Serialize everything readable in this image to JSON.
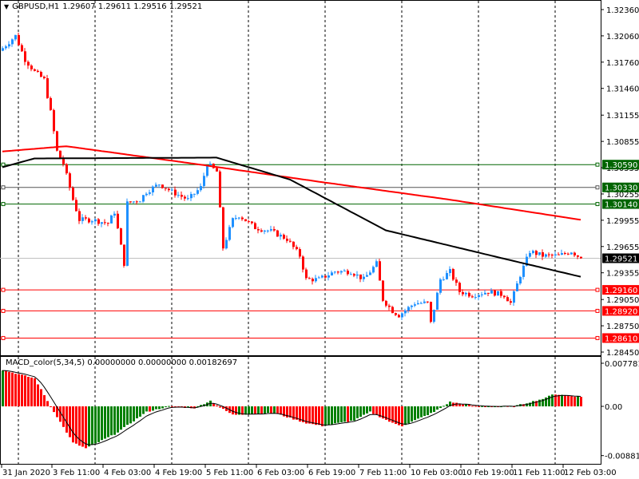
{
  "header": {
    "symbol": "GBPUSD,H1",
    "ohlc": "1.29607 1.29611 1.29516 1.29521"
  },
  "macd_header": {
    "label": "MACD_color(5,34,5) 0.00000000 0.00000000 0.00182697"
  },
  "colors": {
    "bull": "#1e90ff",
    "bear": "#ff0000",
    "ma_red": "#ff0000",
    "ma_black": "#000000",
    "macd_up": "#008000",
    "macd_down": "#ff0000",
    "level_green": "#006400",
    "level_red": "#ff0000"
  },
  "chart_data": {
    "type": "candlestick",
    "symbol": "GBPUSD",
    "timeframe": "H1",
    "ylim": [
      1.2845,
      1.3236
    ],
    "bars": 182,
    "close_anchors": [
      [
        0,
        1.3192
      ],
      [
        4,
        1.3206
      ],
      [
        7,
        1.3179
      ],
      [
        10,
        1.3165
      ],
      [
        13,
        1.3156
      ],
      [
        15,
        1.3119
      ],
      [
        17,
        1.3074
      ],
      [
        19,
        1.306
      ],
      [
        22,
        1.3019
      ],
      [
        24,
        1.2996
      ],
      [
        28,
        1.2996
      ],
      [
        33,
        1.2992
      ],
      [
        35,
        1.3005
      ],
      [
        38,
        1.2946
      ],
      [
        39,
        1.3015
      ],
      [
        43,
        1.3019
      ],
      [
        45,
        1.3028
      ],
      [
        49,
        1.3037
      ],
      [
        53,
        1.3028
      ],
      [
        58,
        1.3019
      ],
      [
        62,
        1.3033
      ],
      [
        64,
        1.306
      ],
      [
        67,
        1.3051
      ],
      [
        69,
        1.2964
      ],
      [
        72,
        1.2996
      ],
      [
        74,
        1.3001
      ],
      [
        79,
        1.2987
      ],
      [
        84,
        1.2983
      ],
      [
        89,
        1.2974
      ],
      [
        93,
        1.2955
      ],
      [
        95,
        1.2928
      ],
      [
        99,
        1.2928
      ],
      [
        104,
        1.2937
      ],
      [
        109,
        1.2937
      ],
      [
        113,
        1.2928
      ],
      [
        117,
        1.2946
      ],
      [
        119,
        1.2905
      ],
      [
        122,
        1.2892
      ],
      [
        124,
        1.2887
      ],
      [
        129,
        1.2901
      ],
      [
        133,
        1.2901
      ],
      [
        134,
        1.2878
      ],
      [
        137,
        1.2928
      ],
      [
        140,
        1.2937
      ],
      [
        143,
        1.2914
      ],
      [
        147,
        1.291
      ],
      [
        152,
        1.2914
      ],
      [
        157,
        1.291
      ],
      [
        159,
        1.2901
      ],
      [
        162,
        1.2933
      ],
      [
        165,
        1.296
      ],
      [
        169,
        1.2955
      ],
      [
        174,
        1.2955
      ],
      [
        178,
        1.296
      ],
      [
        181,
        1.29521
      ]
    ],
    "ma_red": [
      [
        0,
        1.3074
      ],
      [
        20,
        1.308
      ],
      [
        60,
        1.306
      ],
      [
        100,
        1.3039
      ],
      [
        140,
        1.3019
      ],
      [
        181,
        1.2996
      ]
    ],
    "ma_black": [
      [
        0,
        1.3056
      ],
      [
        10,
        1.3066
      ],
      [
        67,
        1.3067
      ],
      [
        90,
        1.3042
      ],
      [
        120,
        1.2984
      ],
      [
        160,
        1.2949
      ],
      [
        181,
        1.2931
      ]
    ],
    "price_ticks": [
      "1.32360",
      "1.32060",
      "1.31760",
      "1.31460",
      "1.31155",
      "1.30855",
      "1.30555",
      "1.30255",
      "1.29955",
      "1.29655",
      "1.29355",
      "1.29050",
      "1.28750",
      "1.28450"
    ],
    "levels": [
      {
        "price": "1.30590",
        "color": "green"
      },
      {
        "price": "1.30330",
        "color": "green",
        "line": "#555555"
      },
      {
        "price": "1.30140",
        "color": "green"
      },
      {
        "price": "1.29160",
        "color": "red"
      },
      {
        "price": "1.28920",
        "color": "red"
      },
      {
        "price": "1.28610",
        "color": "red"
      }
    ],
    "current_price": "1.29521",
    "x_labels": [
      "31 Jan 2020",
      "3 Feb 11:00",
      "4 Feb 03:00",
      "4 Feb 19:00",
      "5 Feb 11:00",
      "6 Feb 03:00",
      "6 Feb 19:00",
      "7 Feb 11:00",
      "10 Feb 03:00",
      "10 Feb 19:00",
      "11 Feb 11:00",
      "12 Feb 03:00"
    ],
    "macd": {
      "ylim": [
        -0.0088146,
        0.0077812
      ],
      "ticks": [
        "0.0077812",
        "0.00",
        "-0.0088146"
      ],
      "anchors": [
        [
          0,
          0.0065
        ],
        [
          10,
          0.005
        ],
        [
          15,
          0.0
        ],
        [
          22,
          -0.0065
        ],
        [
          26,
          -0.0075
        ],
        [
          35,
          -0.005
        ],
        [
          45,
          -0.001
        ],
        [
          52,
          0.0
        ],
        [
          60,
          -0.0003
        ],
        [
          65,
          0.001
        ],
        [
          68,
          -0.0002
        ],
        [
          72,
          -0.0015
        ],
        [
          85,
          -0.0012
        ],
        [
          95,
          -0.003
        ],
        [
          100,
          -0.0035
        ],
        [
          110,
          -0.0025
        ],
        [
          115,
          -0.001
        ],
        [
          122,
          -0.003
        ],
        [
          125,
          -0.0035
        ],
        [
          135,
          -0.001
        ],
        [
          140,
          0.0008
        ],
        [
          148,
          0.0
        ],
        [
          160,
          0.0
        ],
        [
          170,
          0.0015
        ],
        [
          172,
          0.0022
        ],
        [
          181,
          0.0017
        ]
      ]
    }
  }
}
